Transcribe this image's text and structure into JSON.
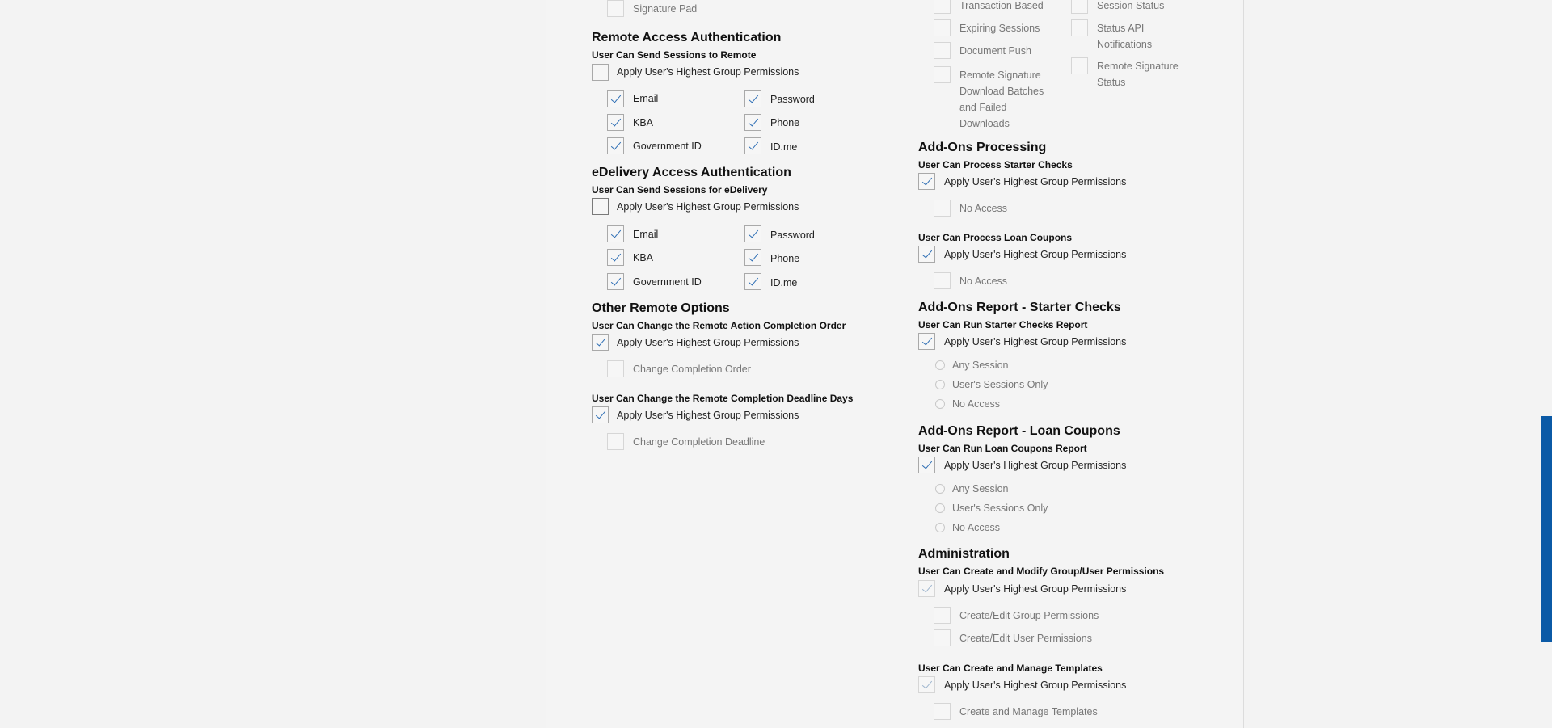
{
  "left": {
    "signature_pad": "Signature Pad",
    "remote": {
      "title": "Remote Access Authentication",
      "sub": "User Can Send Sessions to Remote",
      "apply": "Apply User's Highest Group Permissions",
      "email": "Email",
      "password": "Password",
      "kba": "KBA",
      "phone": "Phone",
      "gov_id": "Government ID",
      "idme": "ID.me"
    },
    "edelivery": {
      "title": "eDelivery Access Authentication",
      "sub": "User Can Send Sessions for eDelivery",
      "apply": "Apply User's Highest Group Permissions",
      "email": "Email",
      "password": "Password",
      "kba": "KBA",
      "phone": "Phone",
      "gov_id": "Government ID",
      "idme": "ID.me"
    },
    "other": {
      "title": "Other Remote Options",
      "sub1": "User Can Change the Remote Action Completion Order",
      "apply1": "Apply User's Highest Group Permissions",
      "change_order": "Change Completion Order",
      "sub2": "User Can Change the Remote Completion Deadline Days",
      "apply2": "Apply User's Highest Group Permissions",
      "change_deadline": "Change Completion Deadline"
    }
  },
  "right": {
    "col1": {
      "transaction": "Transaction Based",
      "expiring": "Expiring Sessions",
      "doc_push": "Document Push",
      "remote_sig": "Remote Signature Download Batches and Failed Downloads"
    },
    "col2": {
      "session_status": "Session Status",
      "status_api": "Status API Notifications",
      "remote_sig_status": "Remote Signature Status"
    },
    "addons_proc": {
      "title": "Add-Ons Processing",
      "sub1": "User Can Process Starter Checks",
      "apply1": "Apply User's Highest Group Permissions",
      "no_access1": "No Access",
      "sub2": "User Can Process Loan Coupons",
      "apply2": "Apply User's Highest Group Permissions",
      "no_access2": "No Access"
    },
    "report_starter": {
      "title": "Add-Ons Report - Starter Checks",
      "sub": "User Can Run Starter Checks Report",
      "apply": "Apply User's Highest Group Permissions",
      "any": "Any Session",
      "users": "User's Sessions Only",
      "none": "No Access"
    },
    "report_loan": {
      "title": "Add-Ons Report - Loan Coupons",
      "sub": "User Can Run Loan Coupons Report",
      "apply": "Apply User's Highest Group Permissions",
      "any": "Any Session",
      "users": "User's Sessions Only",
      "none": "No Access"
    },
    "admin": {
      "title": "Administration",
      "sub1": "User Can Create and Modify Group/User Permissions",
      "apply1": "Apply User's Highest Group Permissions",
      "group_perm": "Create/Edit Group Permissions",
      "user_perm": "Create/Edit User Permissions",
      "sub2": "User Can Create and Manage Templates",
      "apply2": "Apply User's Highest Group Permissions",
      "templates": "Create and Manage Templates"
    }
  }
}
